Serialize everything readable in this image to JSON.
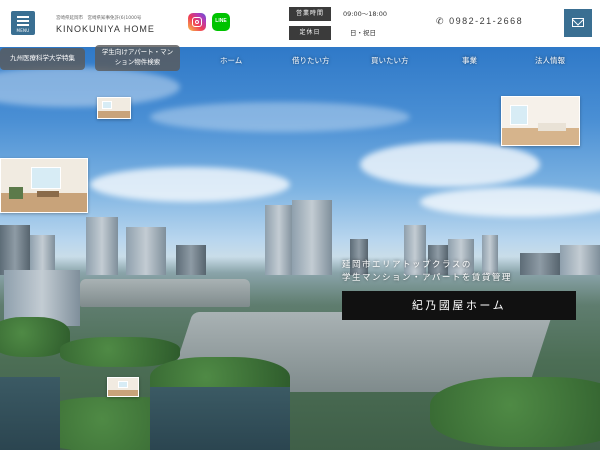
{
  "header": {
    "menu_label": "MENU",
    "logo_tagline": "宮崎県延岡市　宮崎県知事免許(6)1000号",
    "logo_name": "KINOKUNIYA HOME",
    "sns": [
      {
        "name": "instagram-icon"
      },
      {
        "name": "line-icon",
        "label": "LINE"
      }
    ],
    "hours_label": "営業時間",
    "hours_value": "09:00～18:00",
    "holiday_label": "定休日",
    "holiday_value": "日・祝日",
    "phone": "0982-21-2668"
  },
  "side_links": {
    "medical_univ": "九州医療科学大学特集",
    "student_search": "学生向けアパート・マンション物件検索"
  },
  "nav": [
    "ホーム",
    "借りたい方",
    "買いたい方",
    "事業",
    "法人情報"
  ],
  "hero": {
    "catch_line1": "延岡市エリアトップクラスの",
    "catch_line2": "学生マンション・アパートを賃貸管理",
    "brand": "紀乃國屋ホーム"
  },
  "colors": {
    "accent": "#3a6f92",
    "label_bg": "#3b3b3b",
    "brand_box": "#111111"
  }
}
